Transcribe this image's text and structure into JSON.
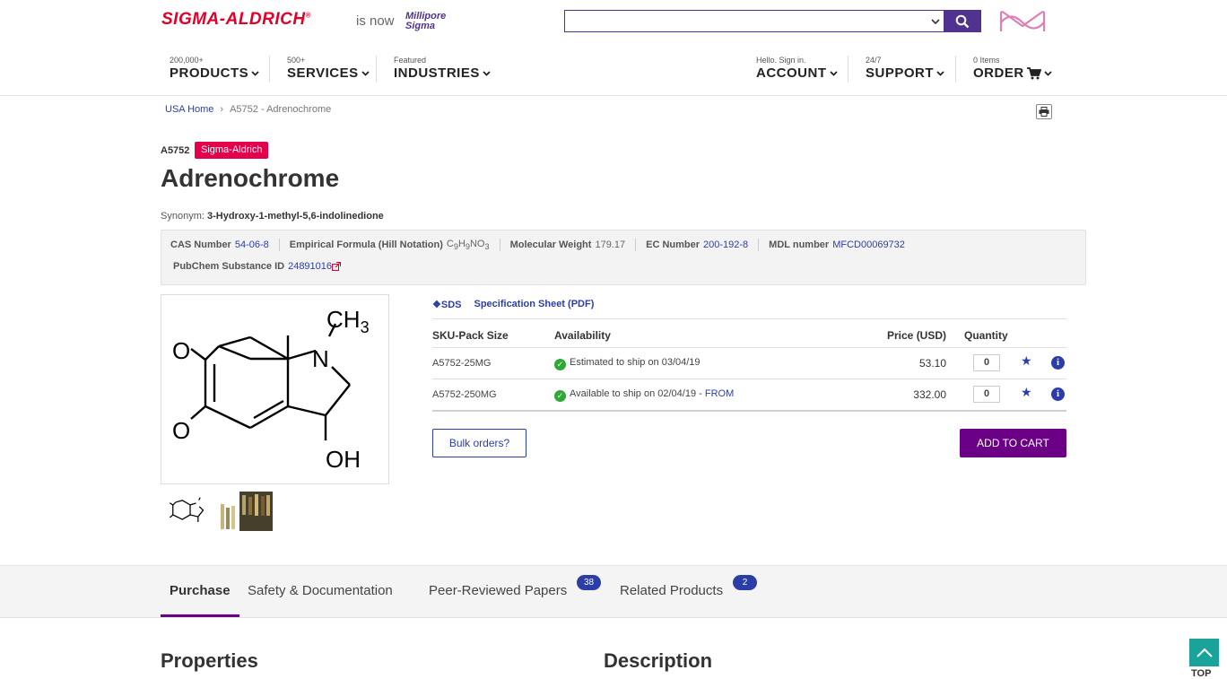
{
  "header": {
    "logo": "SIGMA-ALDRICH",
    "logo_mark": "®",
    "is_now": "is now",
    "new_brand": "MilliporeSigma",
    "search": {
      "value": "",
      "placeholder": ""
    }
  },
  "nav": {
    "products": {
      "small": "200,000+",
      "label": "PRODUCTS"
    },
    "services": {
      "small": "500+",
      "label": "SERVICES"
    },
    "industries": {
      "small": "Featured",
      "label": "INDUSTRIES"
    },
    "account": {
      "small": "Hello. Sign in.",
      "label": "ACCOUNT"
    },
    "support": {
      "small": "24/7",
      "label": "SUPPORT"
    },
    "order": {
      "small": "0 Items",
      "label": "ORDER"
    }
  },
  "breadcrumb": {
    "home": "USA Home",
    "separator": "›",
    "current": "A5752 - Adrenochrome"
  },
  "product": {
    "number": "A5752",
    "brand": "Sigma-Aldrich",
    "brand_color": "#e2004a",
    "name": "Adrenochrome",
    "synonym_label": "Synonym:",
    "synonym": "3-Hydroxy-1-methyl-5,6-indolinedione"
  },
  "properties": {
    "cas_label": "CAS Number",
    "cas": "54-06-8",
    "formula_label": "Empirical Formula (Hill Notation)",
    "formula_c": "C",
    "formula_c_n": "9",
    "formula_h": "H",
    "formula_h_n": "9",
    "formula_rest": "NO",
    "formula_o_n": "3",
    "mw_label": "Molecular Weight",
    "mw": "179.17",
    "ec_label": "EC Number",
    "ec": "200-192-8",
    "mdl_label": "MDL number",
    "mdl": "MFCD00069732",
    "pubchem_label": "PubChem Substance ID",
    "pubchem": "24891016"
  },
  "structure": {
    "ch3": "CH",
    "ch3_sub": "3",
    "n": "N",
    "o1": "O",
    "o2": "O",
    "oh": "OH"
  },
  "docs": {
    "sds": "SDS",
    "spec": "Specification Sheet (PDF)"
  },
  "table": {
    "headers": {
      "sku": "SKU-Pack Size",
      "availability": "Availability",
      "price": "Price (USD)",
      "quantity": "Quantity"
    },
    "rows": [
      {
        "sku": "A5752-25MG",
        "availability": "Estimated to ship on 03/04/19",
        "from": "",
        "price": "53.10",
        "qty": "0"
      },
      {
        "sku": "A5752-250MG",
        "availability": "Available to ship on 02/04/19 - ",
        "from": "FROM",
        "price": "332.00",
        "qty": "0"
      }
    ]
  },
  "actions": {
    "bulk": "Bulk orders?",
    "add_to_cart": "ADD TO CART",
    "cart_color": "#6b0087"
  },
  "tabs": [
    {
      "label": "Purchase",
      "active": true
    },
    {
      "label": "Safety & Documentation"
    },
    {
      "label": "Peer-Reviewed Papers",
      "badge": "38"
    },
    {
      "label": "Related Products",
      "badge": "2"
    }
  ],
  "sections": {
    "properties": "Properties",
    "description": "Description"
  },
  "top_button": "TOP"
}
